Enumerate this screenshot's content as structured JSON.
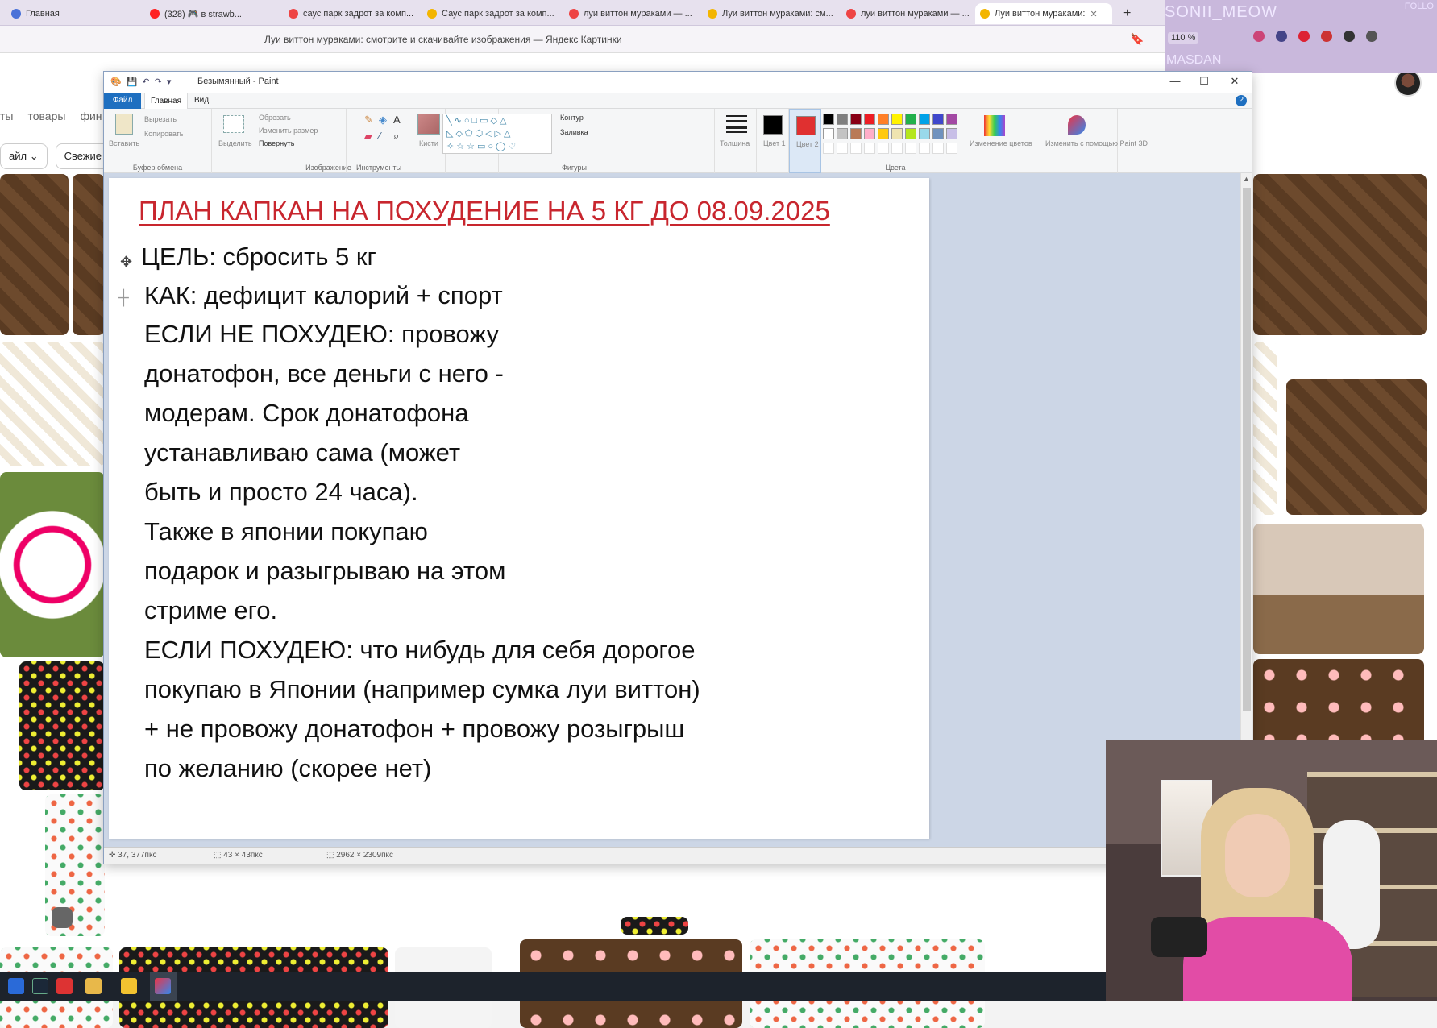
{
  "browser": {
    "tabs": [
      {
        "label": "Главная",
        "color": "#4a72d8"
      },
      {
        "label": "(328) 🎮 в strawb...",
        "color": "#ff2222"
      },
      {
        "label": "саус парк задрот за комп...",
        "color": "#e44"
      },
      {
        "label": "Саус парк задрот за комп...",
        "color": "#f3b500"
      },
      {
        "label": "луи виттон мураками — ...",
        "color": "#e44"
      },
      {
        "label": "Луи виттон мураками: см...",
        "color": "#f3b500"
      },
      {
        "label": "луи виттон мураками — ...",
        "color": "#e44"
      },
      {
        "label": "Луи виттон мураками:",
        "color": "#f3b500"
      }
    ],
    "new_tab_symbol": "+",
    "page_title": "Луи виттон мураками: смотрите и скачивайте изображения — Яндекс Картинки",
    "zoom": "110 %"
  },
  "overlay": {
    "streamer_name": "SONII_MEOW",
    "follow": "FOLLO",
    "sub_name": "MASDAN"
  },
  "yandex": {
    "nav": [
      "ты",
      "товары",
      "фин"
    ],
    "filters": [
      "айл ⌄",
      "Свежие"
    ]
  },
  "paint": {
    "window_title": "Безымянный - Paint",
    "menu": {
      "file": "Файл",
      "home": "Главная",
      "view": "Вид"
    },
    "ribbon": {
      "clipboard": {
        "paste": "Вставить",
        "cut": "Вырезать",
        "copy": "Копировать",
        "label": "Буфер обмена"
      },
      "image": {
        "select": "Выделить",
        "crop": "Обрезать",
        "resize": "Изменить размер",
        "rotate": "Повернуть",
        "label": "Изображение"
      },
      "tools": {
        "label": "Инструменты",
        "brushes": "Кисти"
      },
      "shapes": {
        "outline": "Контур",
        "fill": "Заливка",
        "label": "Фигуры"
      },
      "size": "Толщина",
      "color1": "Цвет 1",
      "color2": "Цвет 2",
      "colors_label": "Цвета",
      "edit_colors": "Изменение цветов",
      "paint3d": "Изменить с помощью Paint 3D"
    },
    "palette_row1": [
      "#000000",
      "#7f7f7f",
      "#880015",
      "#ed1c24",
      "#ff7f27",
      "#fff200",
      "#22b14c",
      "#00a2e8",
      "#3f48cc",
      "#a349a4"
    ],
    "palette_row2": [
      "#ffffff",
      "#c3c3c3",
      "#b97a57",
      "#ffaec9",
      "#ffc90e",
      "#efe4b0",
      "#b5e61d",
      "#99d9ea",
      "#7092be",
      "#c8bfe7"
    ],
    "color1_value": "#000000",
    "color2_value": "#e03030",
    "canvas": {
      "title": "ПЛАН КАПКАН НА ПОХУДЕНИЕ НА 5 КГ ДО 08.09.2025",
      "lines": [
        "ЦЕЛЬ: сбросить 5 кг",
        "КАК: дефицит калорий + спорт",
        "ЕСЛИ НЕ ПОХУДЕЮ: провожу",
        "донатофон, все деньги с него -",
        "модерам. Срок донатофона",
        "устанавливаю сама (может",
        "быть и просто 24 часа).",
        "Также в японии покупаю",
        "подарок и разыгрываю на этом",
        "стриме его.",
        "ЕСЛИ ПОХУДЕЮ: что нибудь для себя дорогое",
        "покупаю в Японии (например сумка луи виттон)",
        "+ не провожу донатофон + провожу розыгрыш",
        "по желанию (скорее нет)"
      ]
    },
    "status": {
      "cursor_pos": "37, 377пкс",
      "selection_size": "43 × 43пкс",
      "image_size": "2962 × 2309пкс"
    }
  }
}
